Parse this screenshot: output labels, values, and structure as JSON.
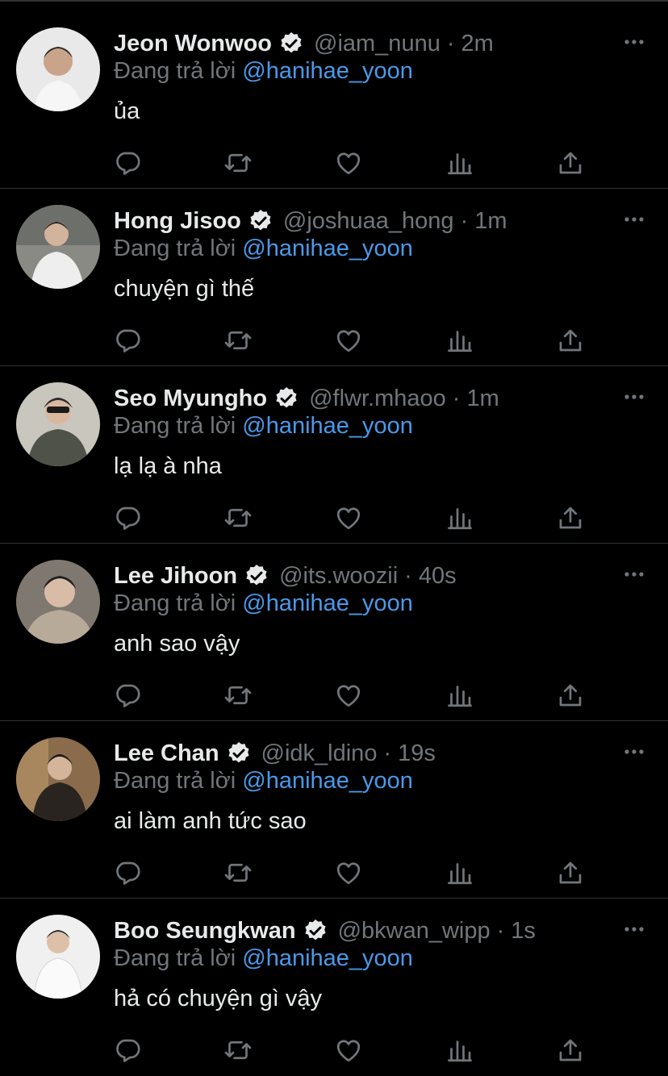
{
  "reply_prefix": "Đang trả lời",
  "colors": {
    "background": "#000000",
    "text": "#e7e9ea",
    "muted": "#71767b",
    "link": "#4a99e9",
    "divider": "#2f3336"
  },
  "icons": [
    "verified-badge-icon",
    "more-icon",
    "reply-icon",
    "retweet-icon",
    "like-icon",
    "views-icon",
    "share-icon"
  ],
  "tweets": [
    {
      "name": "Jeon Wonwoo",
      "handle": "@iam_nunu",
      "time": "2m",
      "mention": "@hanihae_yoon",
      "text": "ủa"
    },
    {
      "name": "Hong Jisoo",
      "handle": "@joshuaa_hong",
      "time": "1m",
      "mention": "@hanihae_yoon",
      "text": "chuyện gì thế"
    },
    {
      "name": "Seo Myungho",
      "handle": "@flwr.mhaoo",
      "time": "1m",
      "mention": "@hanihae_yoon",
      "text": "lạ lạ à nha"
    },
    {
      "name": "Lee Jihoon",
      "handle": "@its.woozii",
      "time": "40s",
      "mention": "@hanihae_yoon",
      "text": "anh sao vậy"
    },
    {
      "name": "Lee Chan",
      "handle": "@idk_ldino",
      "time": "19s",
      "mention": "@hanihae_yoon",
      "text": "ai làm anh tức sao"
    },
    {
      "name": "Boo Seungkwan",
      "handle": "@bkwan_wipp",
      "time": "1s",
      "mention": "@hanihae_yoon",
      "text": "hả có chuyện gì vậy"
    }
  ]
}
